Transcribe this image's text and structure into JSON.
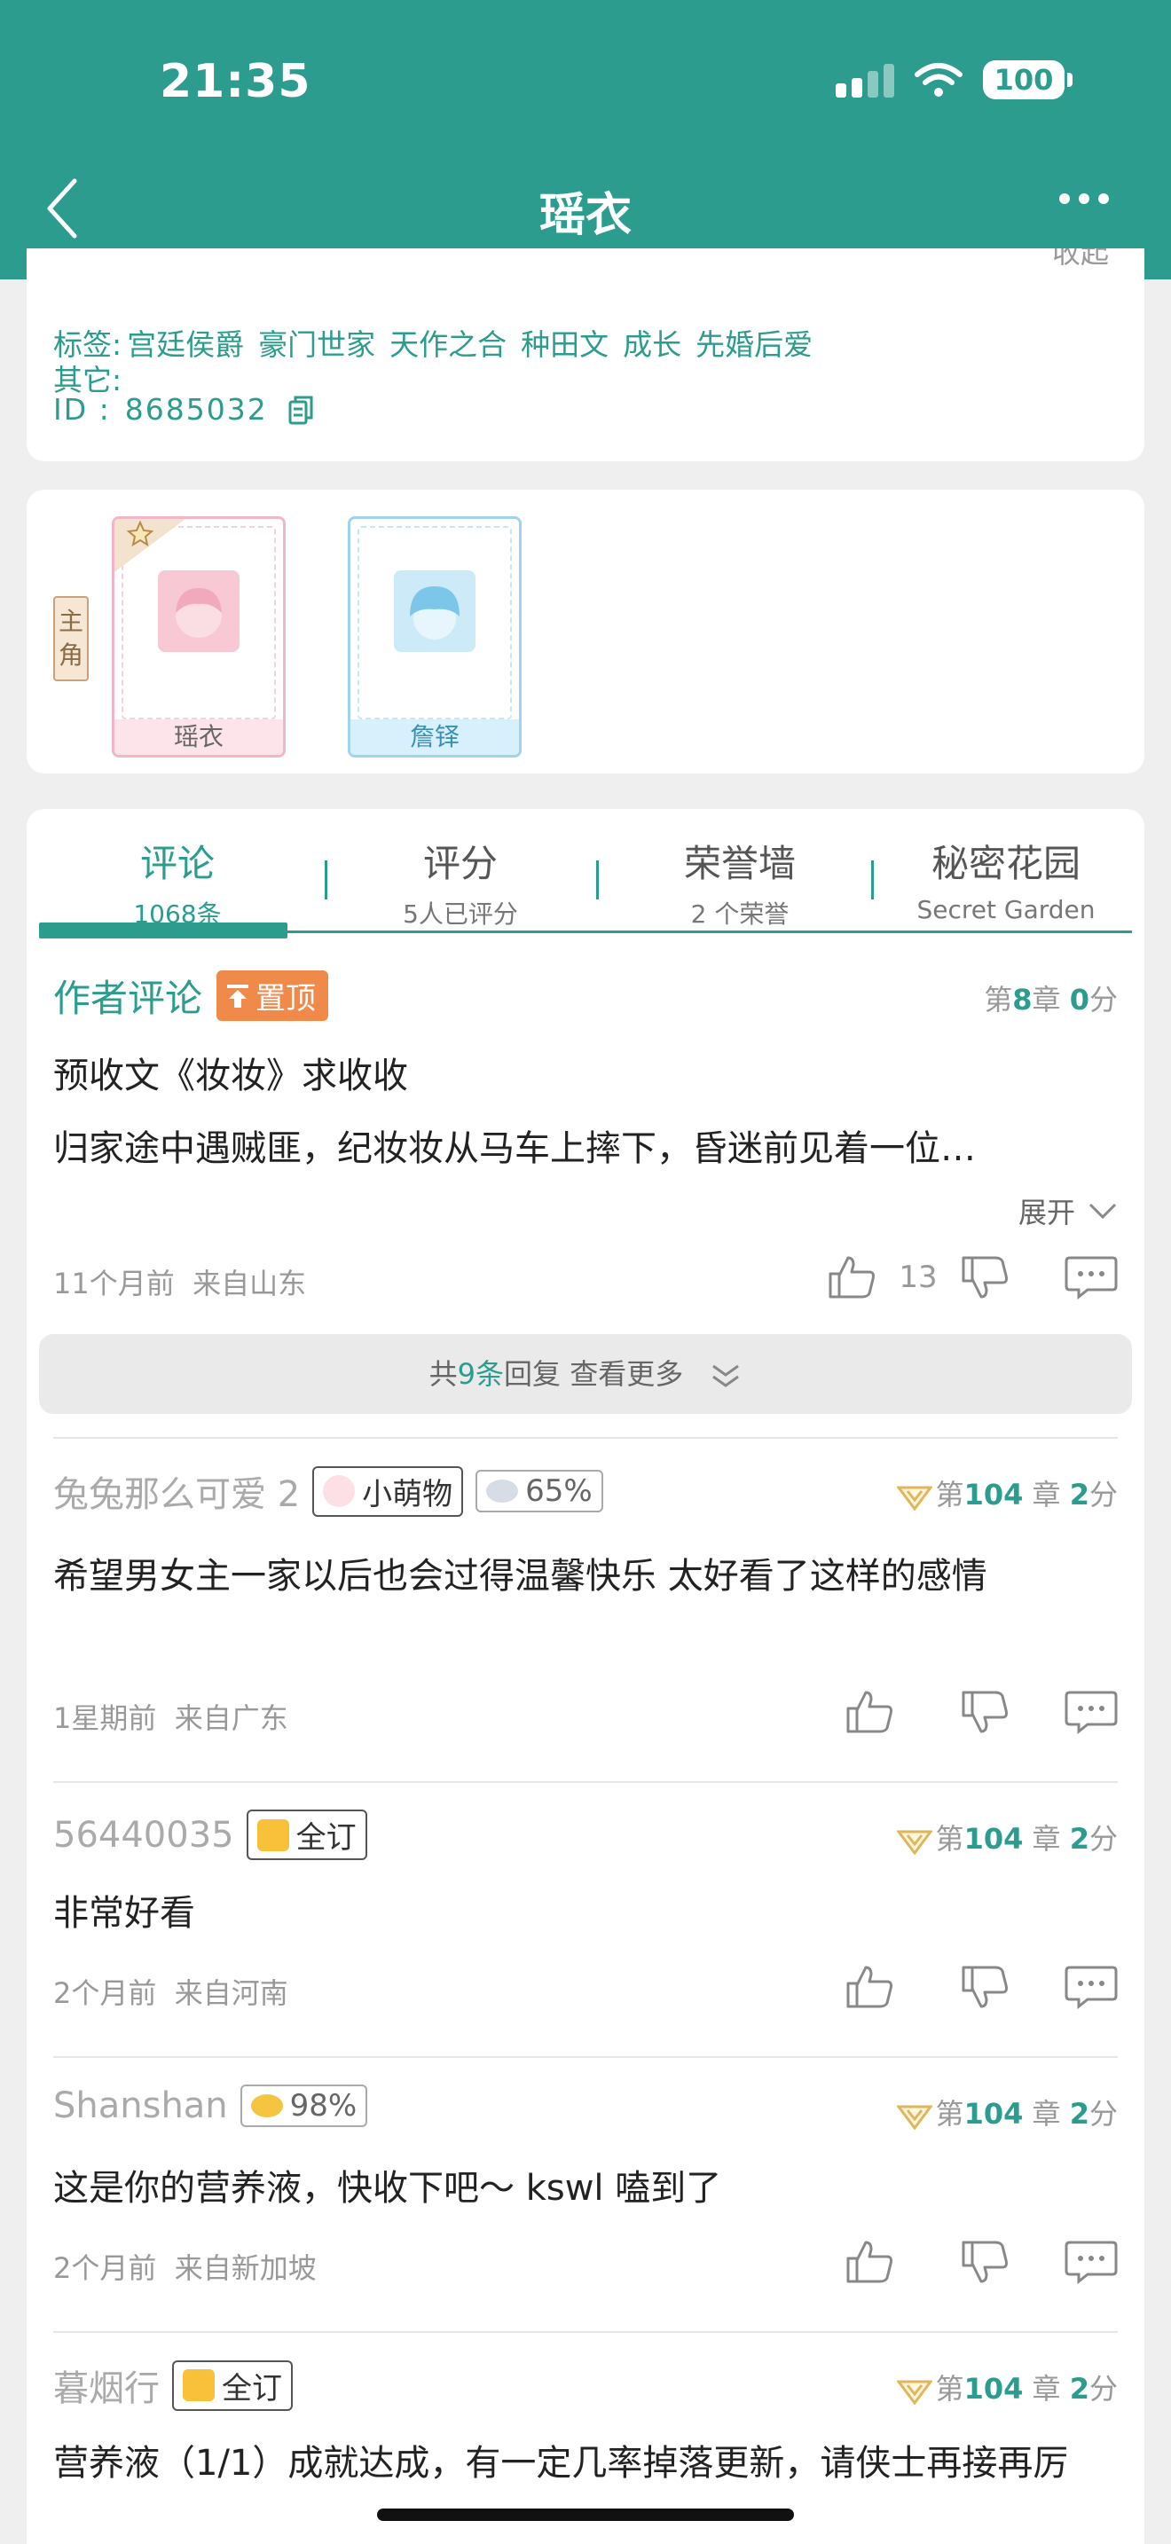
{
  "status": {
    "time": "21:35",
    "battery": "100"
  },
  "nav": {
    "title": "瑶衣"
  },
  "colors": {
    "brand": "#2b9c8d",
    "top_badge": "#f08a4b"
  },
  "info": {
    "cut_text": "收起",
    "tags_label": "标签:",
    "tags": [
      "宫廷侯爵",
      "豪门世家",
      "天作之合",
      "种田文",
      "成长",
      "先婚后爱"
    ],
    "other_label": "其它:",
    "id_label": "ID  :",
    "id_value": "8685032"
  },
  "characters": {
    "lead_tag": [
      "主",
      "角"
    ],
    "items": [
      {
        "name": "瑶衣",
        "theme": "pink"
      },
      {
        "name": "詹铎",
        "theme": "blue"
      }
    ]
  },
  "tabs": [
    {
      "title": "评论",
      "sub": "1068条"
    },
    {
      "title": "评分",
      "sub": "5人已评分"
    },
    {
      "title": "荣誉墙",
      "sub": "2 个荣誉"
    },
    {
      "title": "秘密花园",
      "sub": "Secret Garden"
    }
  ],
  "pinned": {
    "author_label": "作者评论",
    "top_badge": "置顶",
    "chapter_pre": "第",
    "chapter_num": "8",
    "chapter_mid": "章",
    "score": "0",
    "score_unit": "分",
    "title": "预收文《妆妆》求收收",
    "body": "归家途中遇贼匪，纪妆妆从马车上摔下，昏迷前见着一位…",
    "expand": "展开",
    "time": "11个月前",
    "location": "来自山东",
    "likes": "13",
    "reply_pre": "共",
    "reply_count": "9条",
    "reply_post": "回复 查看更多"
  },
  "comments": [
    {
      "user": "兔兔那么可爱 2",
      "badges": [
        {
          "label": "小萌物",
          "icon": "paw-icon"
        },
        {
          "label": "65%",
          "icon": "silver-ingot-icon"
        }
      ],
      "chapter_num": "104",
      "score": "2",
      "text": "希望男女主一家以后也会过得温馨快乐 太好看了这样的感情",
      "time": "1星期前",
      "location": "来自广东"
    },
    {
      "user": "56440035",
      "badges": [
        {
          "label": "全订",
          "icon": "bookmark-icon"
        }
      ],
      "chapter_num": "104",
      "score": "2",
      "text": "非常好看",
      "time": "2个月前",
      "location": "来自河南"
    },
    {
      "user": "Shanshan",
      "badges": [
        {
          "label": "98%",
          "icon": "gold-ingot-icon"
        }
      ],
      "chapter_num": "104",
      "score": "2",
      "text": "这是你的营养液，快收下吧～ kswl 嗑到了",
      "time": "2个月前",
      "location": "来自新加坡"
    },
    {
      "user": "暮烟行",
      "badges": [
        {
          "label": "全订",
          "icon": "bookmark-icon"
        }
      ],
      "chapter_num": "104",
      "score": "2",
      "text": "营养液（1/1）成就达成，有一定几率掉落更新，请侠士再接再厉",
      "time": "",
      "location": ""
    }
  ],
  "labels": {
    "chapter_pre": "第",
    "chapter_mid": "章",
    "score_unit": "分"
  }
}
